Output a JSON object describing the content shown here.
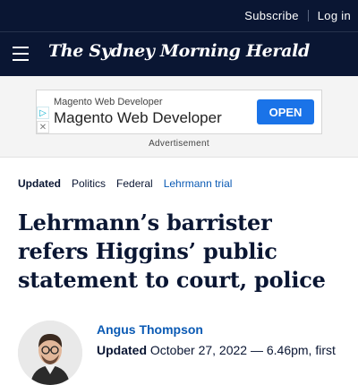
{
  "topbar": {
    "subscribe": "Subscribe",
    "login": "Log in"
  },
  "header": {
    "masthead": "The Sydney Morning Herald",
    "menu_icon": "hamburger-menu-icon"
  },
  "ad": {
    "small_title": "Magento Web Developer",
    "big_title": "Magento Web Developer",
    "button": "OPEN",
    "label": "Advertisement",
    "icons": [
      "adchoices-icon",
      "close-icon"
    ],
    "button_color": "#1a73e8"
  },
  "breadcrumb": {
    "updated": "Updated",
    "items": [
      "Politics",
      "Federal"
    ],
    "tag": "Lehrmann trial"
  },
  "article": {
    "headline": "Lehrmann’s barrister refers Higgins’ public statement to court, police",
    "author": "Angus Thompson",
    "date_label": "Updated",
    "date_text": "October 27, 2022 — 6.46pm, first"
  },
  "colors": {
    "navy": "#0a1633",
    "link_blue": "#0a5ab4"
  }
}
